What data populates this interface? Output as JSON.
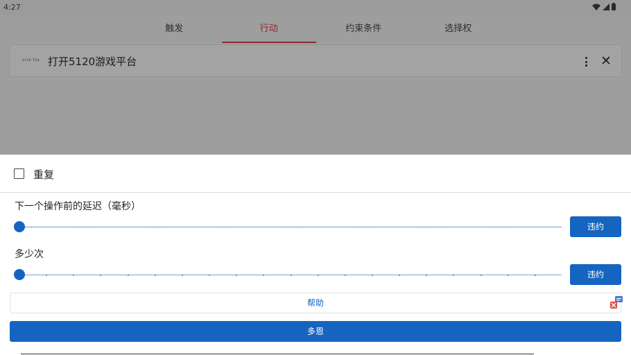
{
  "status_bar": {
    "time": "4:27",
    "icons": [
      "wifi-icon",
      "signal-icon",
      "battery-icon"
    ]
  },
  "tabs": [
    {
      "label": "触发",
      "active": false
    },
    {
      "label": "行动",
      "active": true
    },
    {
      "label": "约束条件",
      "active": false
    },
    {
      "label": "选择权",
      "active": false
    }
  ],
  "action_card": {
    "logo_text": "5120 TEA",
    "title": "打开5120游戏平台"
  },
  "sheet": {
    "repeat": {
      "label": "重复",
      "checked": false
    },
    "delay": {
      "label": "下一个操作前的延迟（毫秒）",
      "button": "违约",
      "value_fraction": 0
    },
    "count": {
      "label": "多少次",
      "button": "违约",
      "value_fraction": 0
    },
    "help_button": "帮助",
    "done_button": "多恩"
  },
  "colors": {
    "accent": "#1565c0",
    "active_tab": "#8b2b33",
    "scrim": "#9e9e9e"
  }
}
